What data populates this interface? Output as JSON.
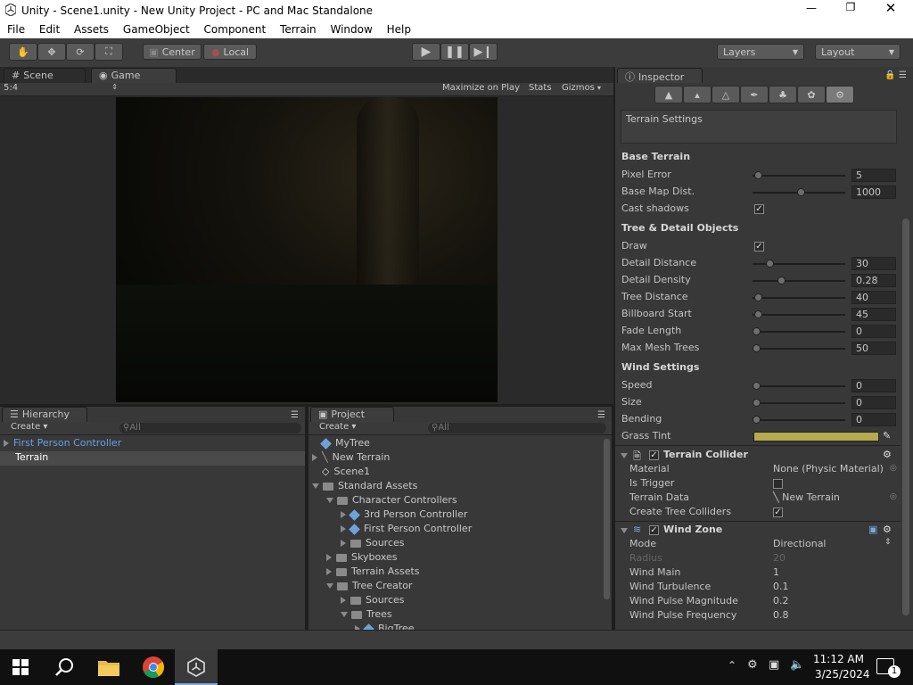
{
  "window": {
    "title": "Unity - Scene1.unity - New Unity Project - PC and Mac Standalone"
  },
  "menu": [
    "File",
    "Edit",
    "Assets",
    "GameObject",
    "Component",
    "Terrain",
    "Window",
    "Help"
  ],
  "toolbar": {
    "center_label": "Center",
    "local_label": "Local",
    "layers_label": "Layers",
    "layout_label": "Layout"
  },
  "tabs": {
    "scene": "Scene",
    "game": "Game",
    "inspector": "Inspector",
    "hierarchy": "Hierarchy",
    "project": "Project"
  },
  "game_bar": {
    "aspect": "5:4",
    "maximize": "Maximize on Play",
    "stats": "Stats",
    "gizmos": "Gizmos"
  },
  "hierarchy": {
    "create": "Create",
    "search_placeholder": "All",
    "items": [
      {
        "label": "First Person Controller",
        "color": "#6a9ee8",
        "expanded": false
      },
      {
        "label": "Terrain",
        "color": "#ffffff",
        "selected": true
      }
    ]
  },
  "project": {
    "create": "Create",
    "search_placeholder": "All",
    "items": [
      {
        "label": "MyTree",
        "indent": 0,
        "icon": "cube",
        "arrow": ""
      },
      {
        "label": "New Terrain",
        "indent": 0,
        "icon": "terrain",
        "arrow": "right"
      },
      {
        "label": "Scene1",
        "indent": 0,
        "icon": "unity",
        "arrow": ""
      },
      {
        "label": "Standard Assets",
        "indent": 0,
        "icon": "folder",
        "arrow": "down"
      },
      {
        "label": "Character Controllers",
        "indent": 1,
        "icon": "folder",
        "arrow": "down"
      },
      {
        "label": "3rd Person Controller",
        "indent": 2,
        "icon": "cube",
        "arrow": "right"
      },
      {
        "label": "First Person Controller",
        "indent": 2,
        "icon": "cube",
        "arrow": "right"
      },
      {
        "label": "Sources",
        "indent": 2,
        "icon": "folder",
        "arrow": "right"
      },
      {
        "label": "Skyboxes",
        "indent": 1,
        "icon": "folder",
        "arrow": "right"
      },
      {
        "label": "Terrain Assets",
        "indent": 1,
        "icon": "folder",
        "arrow": "right"
      },
      {
        "label": "Tree Creator",
        "indent": 1,
        "icon": "folder",
        "arrow": "down"
      },
      {
        "label": "Sources",
        "indent": 2,
        "icon": "folder",
        "arrow": "right"
      },
      {
        "label": "Trees",
        "indent": 2,
        "icon": "folder",
        "arrow": "down"
      },
      {
        "label": "BigTree",
        "indent": 3,
        "icon": "cube",
        "arrow": "right"
      }
    ]
  },
  "inspector": {
    "header": "Terrain Settings",
    "base_terrain": {
      "title": "Base Terrain",
      "rows": [
        {
          "label": "Pixel Error",
          "value": "5",
          "pos": 0.02
        },
        {
          "label": "Base Map Dist.",
          "value": "1000",
          "pos": 0.5
        }
      ],
      "cast_shadows": "Cast shadows"
    },
    "tree_detail": {
      "title": "Tree & Detail Objects",
      "draw": "Draw",
      "rows": [
        {
          "label": "Detail Distance",
          "value": "30",
          "pos": 0.15
        },
        {
          "label": "Detail Density",
          "value": "0.28",
          "pos": 0.28
        },
        {
          "label": "Tree Distance",
          "value": "40",
          "pos": 0.02
        },
        {
          "label": "Billboard Start",
          "value": "45",
          "pos": 0.02
        },
        {
          "label": "Fade Length",
          "value": "0",
          "pos": 0.0
        },
        {
          "label": "Max Mesh Trees",
          "value": "50",
          "pos": 0.0
        }
      ]
    },
    "wind": {
      "title": "Wind Settings",
      "rows": [
        {
          "label": "Speed",
          "value": "0",
          "pos": 0
        },
        {
          "label": "Size",
          "value": "0",
          "pos": 0
        },
        {
          "label": "Bending",
          "value": "0",
          "pos": 0
        }
      ],
      "grass_tint": "Grass Tint",
      "grass_tint_color": "#b5ab4e"
    },
    "collider": {
      "title": "Terrain Collider",
      "rows": [
        {
          "label": "Material",
          "value": "None (Physic Material)"
        },
        {
          "label": "Is Trigger",
          "value": ""
        },
        {
          "label": "Terrain Data",
          "value": "New Terrain"
        },
        {
          "label": "Create Tree Colliders",
          "value": ""
        }
      ]
    },
    "windzone": {
      "title": "Wind Zone",
      "rows": [
        {
          "label": "Mode",
          "value": "Directional"
        },
        {
          "label": "Radius",
          "value": "20"
        },
        {
          "label": "Wind Main",
          "value": "1"
        },
        {
          "label": "Wind Turbulence",
          "value": "0.1"
        },
        {
          "label": "Wind Pulse Magnitude",
          "value": "0.2"
        },
        {
          "label": "Wind Pulse Frequency",
          "value": "0.8"
        }
      ]
    }
  },
  "taskbar": {
    "time": "11:12 AM",
    "date": "3/25/2024",
    "notification_count": "1"
  }
}
